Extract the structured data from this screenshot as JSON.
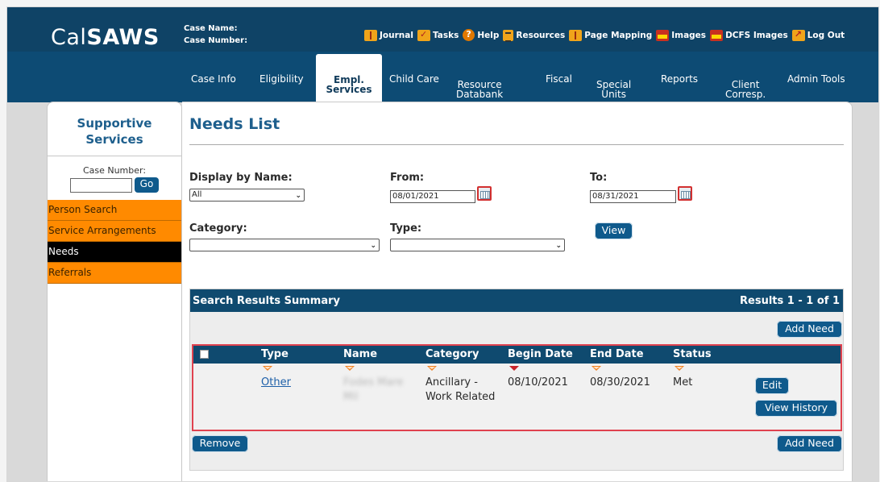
{
  "app": {
    "logo_pre": "Cal",
    "logo_bold": "SAWS",
    "case_name_label": "Case Name:",
    "case_number_label": "Case Number:"
  },
  "header_links": [
    {
      "label": "Journal",
      "icon": "journal-icon"
    },
    {
      "label": "Tasks",
      "icon": "tasks-icon"
    },
    {
      "label": "Help",
      "icon": "help-icon"
    },
    {
      "label": "Resources",
      "icon": "resources-icon"
    },
    {
      "label": "Page Mapping",
      "icon": "page-mapping-icon"
    },
    {
      "label": "Images",
      "icon": "images-icon"
    },
    {
      "label": "DCFS Images",
      "icon": "dcfs-images-icon"
    },
    {
      "label": "Log Out",
      "icon": "logout-icon"
    }
  ],
  "nav": {
    "tabs": [
      {
        "label": "Case Info",
        "l2": ""
      },
      {
        "label": "Eligibility",
        "l2": ""
      },
      {
        "label": "Empl.",
        "l2": "Services",
        "active": true
      },
      {
        "label": "Child Care",
        "l2": ""
      },
      {
        "label": "Resource",
        "l2": "Databank"
      },
      {
        "label": "Fiscal",
        "l2": ""
      },
      {
        "label": "Special",
        "l2": "Units"
      },
      {
        "label": "Reports",
        "l2": ""
      },
      {
        "label": "Client",
        "l2": "Corresp."
      },
      {
        "label": "Admin Tools",
        "l2": ""
      }
    ]
  },
  "sidebar": {
    "title_line1": "Supportive",
    "title_line2": "Services",
    "case_number_label": "Case Number:",
    "case_number_value": "",
    "go_label": "Go",
    "items": [
      {
        "label": "Person Search",
        "selected": false
      },
      {
        "label": "Service Arrangements",
        "selected": false
      },
      {
        "label": "Needs",
        "selected": true
      },
      {
        "label": "Referrals",
        "selected": false
      }
    ]
  },
  "main": {
    "title": "Needs List",
    "display_by_name_label": "Display by Name:",
    "display_by_name_value": "All",
    "from_label": "From:",
    "from_value": "08/01/2021",
    "to_label": "To:",
    "to_value": "08/31/2021",
    "category_label": "Category:",
    "category_value": "",
    "type_label": "Type:",
    "type_value": "",
    "view_label": "View"
  },
  "results": {
    "title": "Search Results Summary",
    "range": "Results 1 - 1 of 1",
    "add_need_label": "Add Need",
    "remove_label": "Remove",
    "columns": [
      "Type",
      "Name",
      "Category",
      "Begin Date",
      "End Date",
      "Status"
    ],
    "rows": [
      {
        "type": "Other",
        "name_line1": "Fodes Mare",
        "name_line2": "Mil",
        "category_line1": "Ancillary -",
        "category_line2": "Work Related",
        "begin_date": "08/10/2021",
        "end_date": "08/30/2021",
        "status": "Met",
        "edit_label": "Edit",
        "view_history_label": "View History"
      }
    ]
  },
  "colors": {
    "header_bg": "#0f4366",
    "nav_bg": "#0d4b74",
    "accent_orange": "#ff8a00",
    "button_blue": "#0f5a8c",
    "highlight_red": "#e0424f"
  }
}
